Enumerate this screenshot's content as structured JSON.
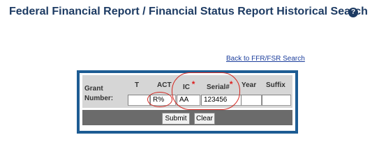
{
  "header": {
    "title": "Federal Financial Report / Financial Status Report Historical Search",
    "help_icon_text": "?"
  },
  "back_link": "Back to FFR/FSR Search",
  "form": {
    "grant_label": "Grant Number:",
    "columns": {
      "t": "T",
      "act": "ACT",
      "ic": "IC",
      "serial": "Serial#",
      "year": "Year",
      "suffix": "Suffix"
    },
    "required_marker": "*",
    "values": {
      "t": "",
      "act": "R%",
      "ic": "AA",
      "serial": "123456",
      "year": "",
      "suffix": ""
    }
  },
  "buttons": {
    "submit": "Submit",
    "clear": "Clear"
  },
  "colors": {
    "title": "#1d3b63",
    "frame": "#1d5c93",
    "form_bg": "#d6d6d6",
    "button_bar": "#6b6b6b",
    "required": "#dd1c1c",
    "annotation": "#d4261f"
  }
}
